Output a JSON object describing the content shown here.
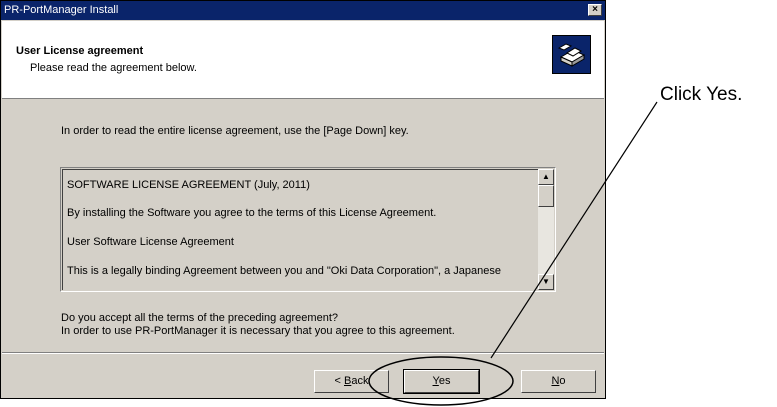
{
  "window": {
    "title": "PR-PortManager Install",
    "close_glyph": "×"
  },
  "header": {
    "title": "User License agreement",
    "subtitle": "Please read the agreement below.",
    "icon": "setup-computer-icon"
  },
  "instruction": "In order to read the entire license agreement, use the [Page Down] key.",
  "license": {
    "lines": [
      "SOFTWARE LICENSE AGREEMENT (July, 2011)",
      "By installing the Software you agree to the terms of this License Agreement.",
      "User Software License Agreement",
      "This is a legally binding Agreement between you and \"Oki Data Corporation\", a Japanese"
    ],
    "scroll_up_glyph": "▲",
    "scroll_down_glyph": "▼"
  },
  "question": {
    "line1": "Do you accept all the terms of the preceding agreement?",
    "line2": "In order to use PR-PortManager it is necessary that you agree to this agreement."
  },
  "buttons": {
    "back_prefix": "< ",
    "back_mnemonic": "B",
    "back_rest": "ack",
    "yes_mnemonic": "Y",
    "yes_rest": "es",
    "no_mnemonic": "N",
    "no_rest": "o"
  },
  "annotation": {
    "callout": "Click Yes."
  }
}
